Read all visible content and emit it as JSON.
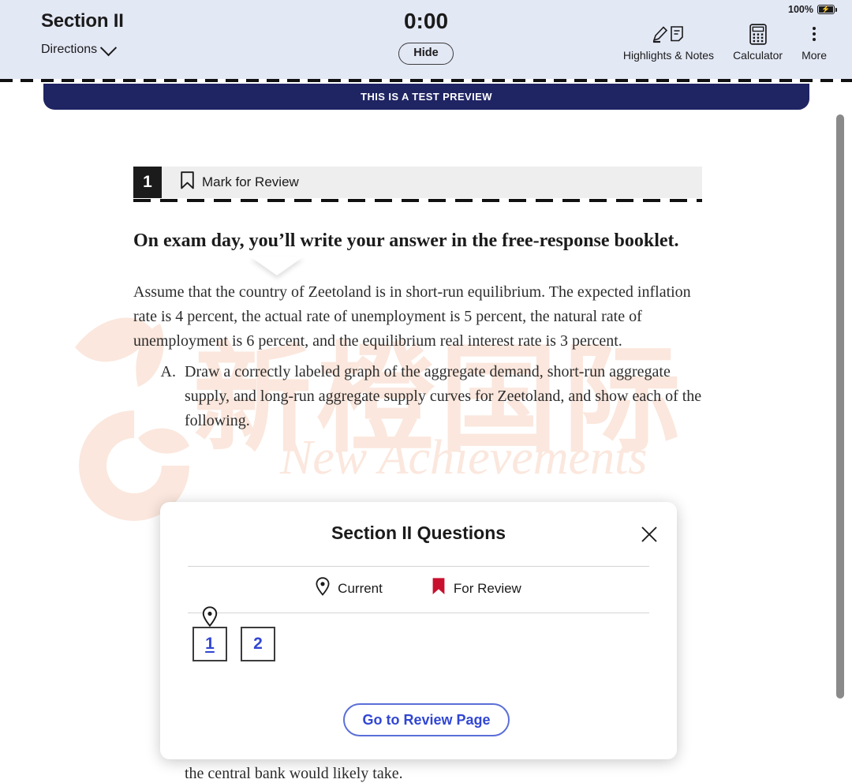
{
  "header": {
    "section_title": "Section II",
    "directions_label": "Directions",
    "directions_icon": "chevron-down-icon",
    "timer": "0:00",
    "hide_timer_label": "Hide",
    "battery_percent": "100%",
    "battery_icon": "battery-charging-icon",
    "tools": [
      {
        "label": "Highlights & Notes",
        "icon": "highlighter-note-icon"
      },
      {
        "label": "Calculator",
        "icon": "calculator-icon"
      },
      {
        "label": "More",
        "icon": "more-vertical-icon"
      }
    ]
  },
  "banner": {
    "text": "THIS IS A TEST PREVIEW",
    "background": "#1f2463",
    "color": "#ffffff"
  },
  "question": {
    "number": "1",
    "mark_for_review_label": "Mark for Review",
    "bookmark_icon": "bookmark-icon",
    "exam_day_note": "On exam day, you’ll write your answer in the free-response booklet.",
    "stimulus": "Assume that the country of Zeetoland is in short-run equilibrium. The expected inflation rate is 4 percent, the actual rate of unemployment is 5 percent, the natural rate of unemployment is 6 percent, and the equilibrium real interest rate is 3 percent.",
    "parts": [
      {
        "letter": "A.",
        "text": "Draw a correctly labeled graph of the aggregate demand, short-run aggregate supply, and long-run aggregate supply curves for Zeetoland, and show each of the following."
      }
    ],
    "obscured_tail_line": "the central bank would likely take."
  },
  "popover": {
    "title": "Section II Questions",
    "close_icon": "close-icon",
    "legend": [
      {
        "label": "Current",
        "icon": "location-pin-icon",
        "color": "#1b1b1b"
      },
      {
        "label": "For Review",
        "icon": "bookmark-flag-icon",
        "color": "#c8102e"
      }
    ],
    "questions": [
      {
        "number": "1",
        "current": true,
        "for_review": false
      },
      {
        "number": "2",
        "current": false,
        "for_review": false
      }
    ],
    "review_button_label": "Go to Review Page",
    "accent_color": "#3146d3"
  },
  "watermark": {
    "chinese_text": "新橙国际",
    "english_text": "New Achievements",
    "color": "#fbe7dd"
  },
  "scrollbar": {
    "orientation": "vertical",
    "thumb_color": "#8a8a8a"
  }
}
